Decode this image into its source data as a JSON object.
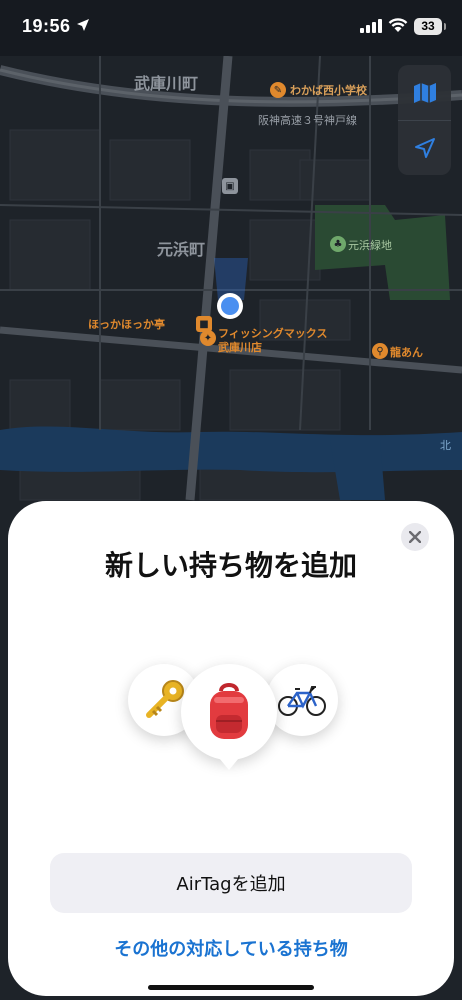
{
  "status_bar": {
    "time": "19:56",
    "battery": "33"
  },
  "map": {
    "labels": {
      "district_1": "武庫川町",
      "district_2": "元浜町",
      "school": "わかば西小学校",
      "highway": "阪神高速３号神戸線",
      "park": "元浜緑地",
      "restaurant_1": "ほっかほっか亭",
      "shop": "フィッシングマックス武庫川店",
      "restaurant_2": "龍あん",
      "edge": "北"
    }
  },
  "sheet": {
    "title": "新しい持ち物を追加",
    "items": [
      "key",
      "backpack",
      "bicycle"
    ],
    "primary_button": "AirTagを追加",
    "secondary_link": "その他の対応している持ち物"
  },
  "colors": {
    "accent": "#1a73d1",
    "map_bg": "#1e2329",
    "poi_orange": "#e0892d",
    "park_green": "#2f5a3a"
  }
}
